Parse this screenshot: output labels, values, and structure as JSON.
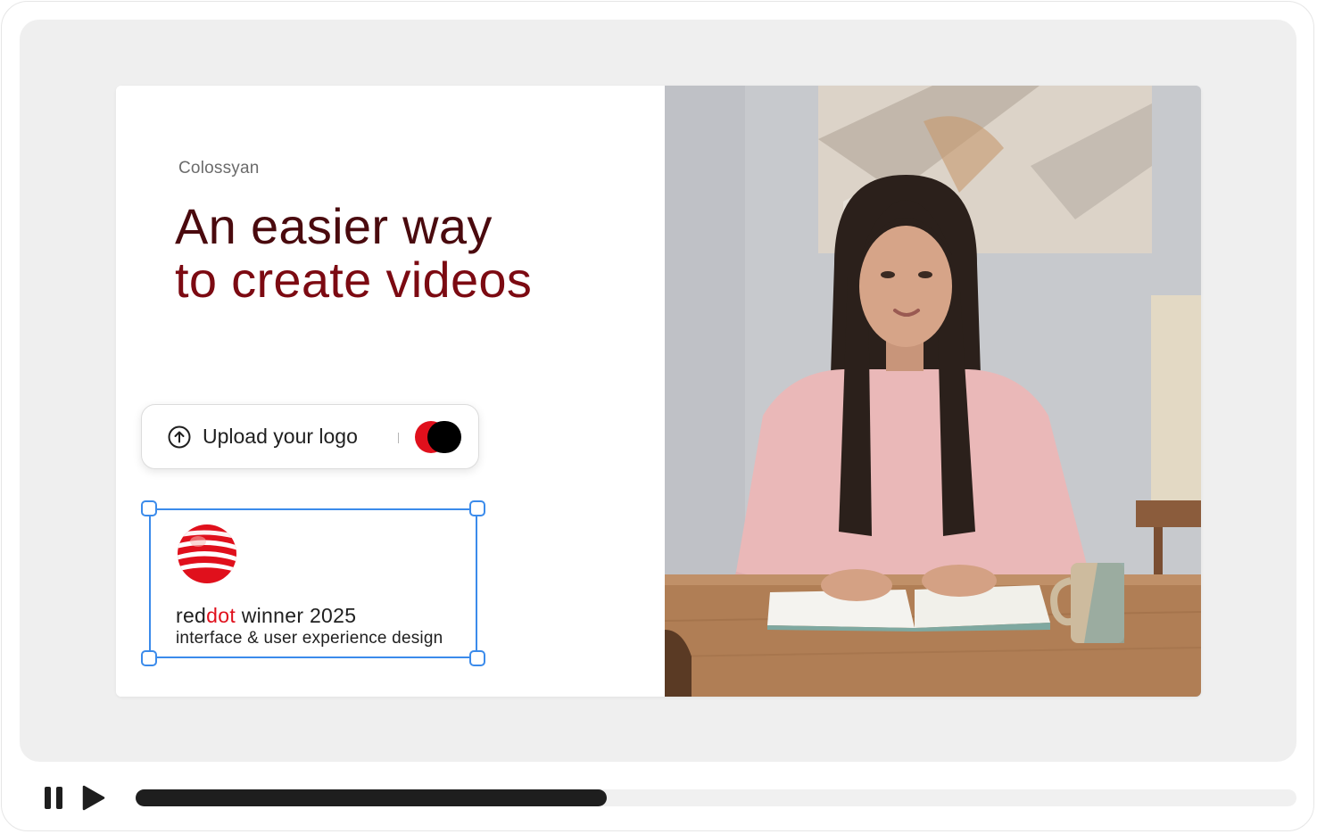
{
  "slide": {
    "brand": "Colossyan",
    "headline_line1": "An easier way",
    "headline_line2": "to create videos",
    "upload": {
      "label": "Upload your logo",
      "icon": "upload-arrow-icon",
      "toggle_colors": [
        "#e0101c",
        "#000000"
      ]
    },
    "award": {
      "brand_part1": "red",
      "brand_part2": "dot",
      "winner_text": " winner 2025",
      "subtitle": "interface & user experience design",
      "icon": "reddot-logo-icon"
    },
    "video": {
      "icon": "presenter-video"
    }
  },
  "player": {
    "pause_icon": "pause-icon",
    "play_icon": "play-icon",
    "progress_fraction": 0.406
  },
  "colors": {
    "accent_blue": "#3b8beb",
    "headline_dark": "#4a0a0e",
    "headline_red": "#7c0a12",
    "reddot_red": "#e0101c"
  }
}
